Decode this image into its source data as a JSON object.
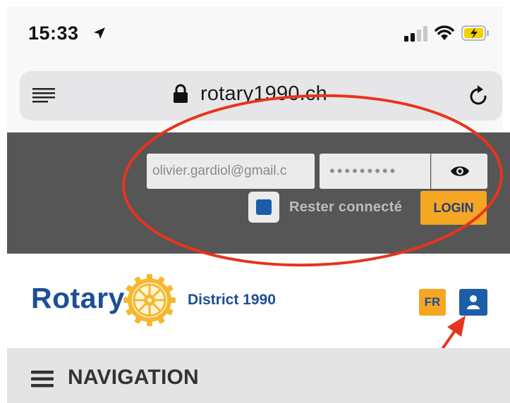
{
  "status_bar": {
    "time": "15:33",
    "icons": [
      "location-arrow-icon",
      "signal-icon",
      "wifi-icon",
      "battery-charging-icon"
    ]
  },
  "browser": {
    "url": "rotary1990.ch",
    "icons": [
      "reader-icon",
      "lock-icon",
      "reload-icon"
    ]
  },
  "login": {
    "email_value": "olivier.gardiol@gmail.c",
    "password_mask": "•••••••••",
    "remember_label": "Rester connecté",
    "remember_checked": true,
    "login_label": "LOGIN"
  },
  "header": {
    "logo_text": "Rotary",
    "district": "District 1990",
    "lang_label": "FR",
    "user_icon": "user-icon"
  },
  "nav": {
    "label": "NAVIGATION",
    "icon": "hamburger-icon"
  },
  "colors": {
    "rotary_blue": "#1d4f96",
    "rotary_gold": "#f5a623",
    "login_band": "#565656",
    "annotation_red": "#e8341c"
  }
}
